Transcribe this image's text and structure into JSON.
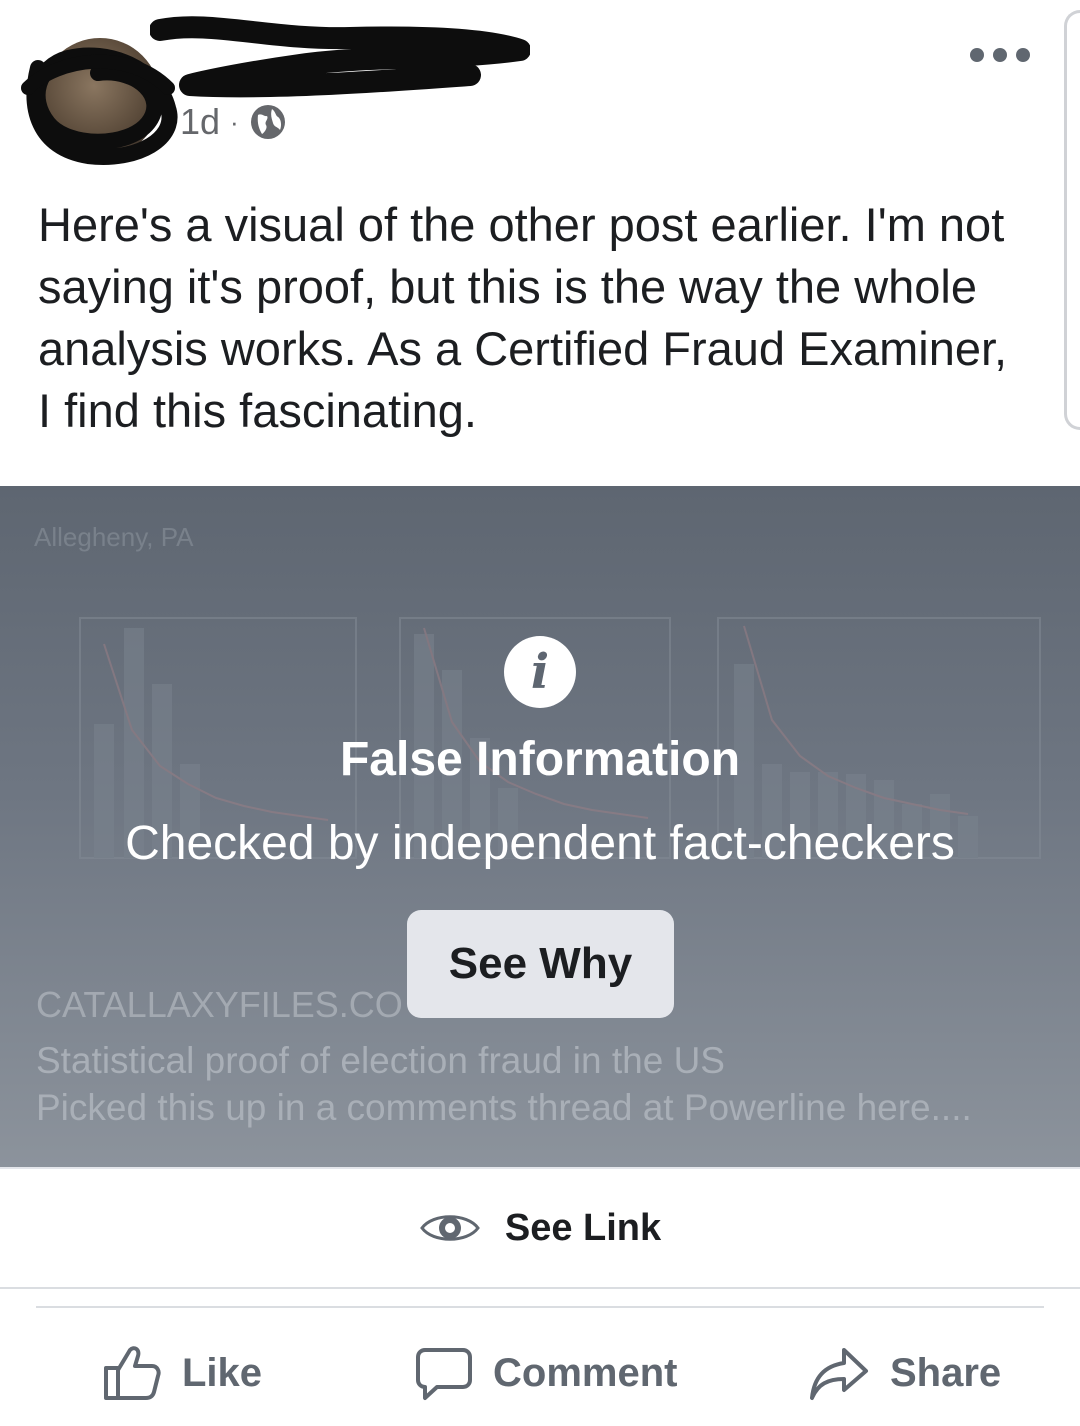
{
  "post": {
    "timestamp": "1d",
    "separator": "·",
    "audience_icon": "globe-icon",
    "more_icon": "more-dots-icon",
    "text_lines": [
      "Here's a visual of the other post earlier.  I'm not",
      "saying it's proof, but this is the way the whole",
      "analysis works.  As a Certified Fraud Examiner,",
      "I find this fascinating."
    ]
  },
  "link_preview": {
    "image_title": "Allegheny, PA",
    "domain": "CATALLAXYFILES.CO",
    "title": "Statistical proof of election fraud in the US",
    "description": "Picked this up in a comments thread at Powerline here...."
  },
  "fact_check": {
    "icon": "info-icon",
    "glyph": "i",
    "title": "False Information",
    "subtitle": "Checked by independent fact-checkers",
    "button_label": "See Why"
  },
  "see_link": {
    "icon": "eye-icon",
    "label": "See Link"
  },
  "actions": {
    "like": "Like",
    "comment": "Comment",
    "share": "Share"
  },
  "colors": {
    "overlay_top": "#5e6671",
    "overlay_bottom": "#8c939c",
    "button_bg": "#e4e6eb",
    "secondary_text": "#65676b",
    "action_text": "#606770"
  }
}
